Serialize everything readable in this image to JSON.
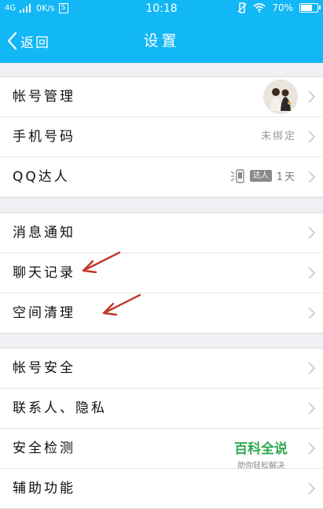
{
  "status_bar": {
    "network": "4G",
    "speed": "0K/s",
    "speed_badge": "S",
    "time": "10:18",
    "battery_percent_text": "70%",
    "battery_level": 0.7
  },
  "nav": {
    "back_label": "返回",
    "title": "设置"
  },
  "groups": [
    {
      "items": [
        {
          "label": "帐号管理"
        },
        {
          "label": "手机号码",
          "value": "未绑定"
        },
        {
          "label": "QQ达人",
          "badge": "达人",
          "days": "1天"
        }
      ]
    },
    {
      "items": [
        {
          "label": "消息通知"
        },
        {
          "label": "聊天记录"
        },
        {
          "label": "空间清理"
        }
      ]
    },
    {
      "items": [
        {
          "label": "帐号安全"
        },
        {
          "label": "联系人、隐私"
        },
        {
          "label": "安全检测"
        },
        {
          "label": "辅助功能"
        }
      ]
    }
  ],
  "watermark": {
    "main": "百科全说",
    "sub": "助你轻松解决"
  },
  "colors": {
    "brand": "#12b7f5",
    "annotation_arrow": "#c0392b"
  }
}
